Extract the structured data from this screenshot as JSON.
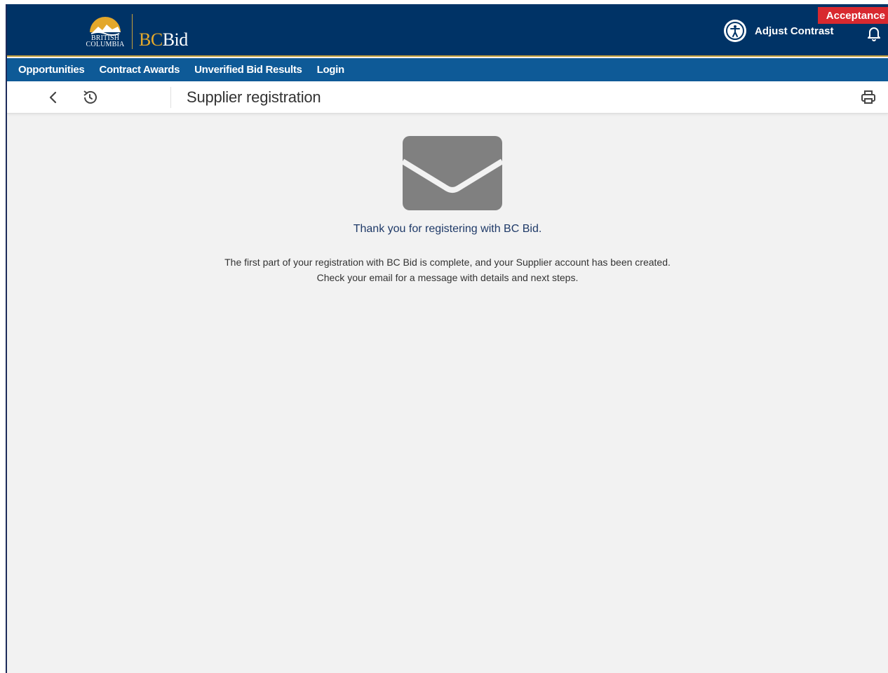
{
  "header": {
    "logo_line1": "BRITISH",
    "logo_line2": "COLUMBIA",
    "brand_bc": "BC",
    "brand_bid": "Bid",
    "adjust_contrast_label": "Adjust Contrast",
    "environment_badge": "Acceptance",
    "icons": {
      "accessibility": "accessibility-icon",
      "notifications": "bell-icon"
    }
  },
  "nav": {
    "items": [
      {
        "label": "Opportunities"
      },
      {
        "label": "Contract Awards"
      },
      {
        "label": "Unverified Bid Results"
      },
      {
        "label": "Login"
      }
    ]
  },
  "titlebar": {
    "title": "Supplier registration",
    "icons": {
      "back": "chevron-left-icon",
      "history": "history-icon",
      "print": "printer-icon"
    }
  },
  "content": {
    "icon": "envelope-icon",
    "heading": "Thank you for registering with BC Bid.",
    "line1": "The first part of your registration with BC Bid is complete, and your Supplier account has been created.",
    "line2": "Check your email for a message with details and next steps."
  },
  "colors": {
    "header_bg": "#003366",
    "nav_bg": "#0e5a97",
    "accent_gold": "#c5a13a",
    "badge_red": "#d8292f",
    "heading_blue": "#1f3a68",
    "envelope_gray": "#808080"
  }
}
